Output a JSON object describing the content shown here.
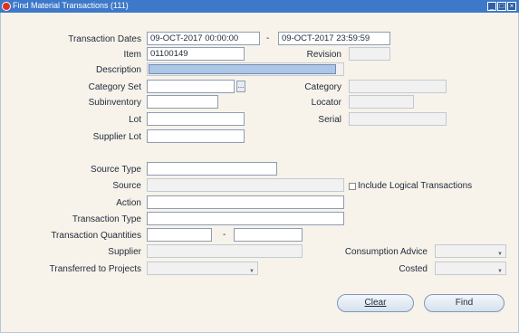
{
  "window": {
    "title": "Find Material Transactions (111)"
  },
  "form": {
    "transaction_dates_label": "Transaction Dates",
    "date_from": "09-OCT-2017 00:00:00",
    "date_to": "09-OCT-2017 23:59:59",
    "item_label": "Item",
    "item_value": "01100149",
    "revision_label": "Revision",
    "description_label": "Description",
    "category_set_label": "Category Set",
    "lov_label": "...",
    "category_label": "Category",
    "subinventory_label": "Subinventory",
    "locator_label": "Locator",
    "lot_label": "Lot",
    "serial_label": "Serial",
    "supplier_lot_label": "Supplier Lot",
    "source_type_label": "Source Type",
    "source_label": "Source",
    "include_logical_label": "Include Logical Transactions",
    "action_label": "Action",
    "transaction_type_label": "Transaction Type",
    "transaction_quantities_label": "Transaction Quantities",
    "supplier_label": "Supplier",
    "consumption_advice_label": "Consumption Advice",
    "transferred_to_projects_label": "Transferred to Projects",
    "costed_label": "Costed"
  },
  "buttons": {
    "clear": "Clear",
    "find": "Find"
  },
  "colors": {
    "titlebar": "#3e79c9",
    "background": "#f7f3ea",
    "selected_field": "#adc6e4"
  }
}
